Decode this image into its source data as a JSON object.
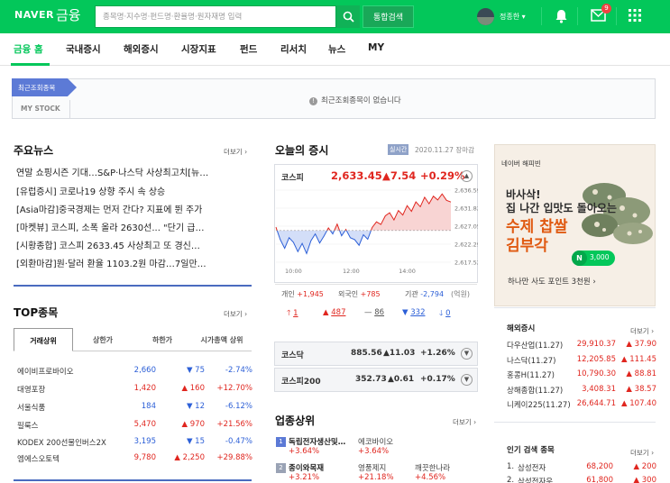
{
  "header": {
    "logo": "NAVER",
    "logo_sub": "금융",
    "search_placeholder": "종목명·지수명·펀드명·환율명·원자재명 입력",
    "total_search": "통합검색",
    "username": "정종한 ▾",
    "mail_badge": "9"
  },
  "nav": {
    "items": [
      "금융 홈",
      "국내증시",
      "해외증시",
      "시장지표",
      "펀드",
      "리서치",
      "뉴스",
      "MY"
    ]
  },
  "recent": {
    "tag": "최근조회종목",
    "mystock": "MY STOCK",
    "message": "최근조회종목이 없습니다"
  },
  "news": {
    "title": "주요뉴스",
    "more": "더보기",
    "items": [
      "연말 쇼핑시즌 기대…S&P·나스닥 사상최고치[뉴…",
      "[유럽증시] 코로나19 상향 주시 속 상승",
      "[Asia마감]중국경제는 먼저 간다? 지표에 뛴 주가",
      "[마켓뷰] 코스피, 소폭 올라 2630선... \"단기 급…",
      "[시황종합] 코스피 2633.45 사상최고 또 경신…",
      "[외환마감]원·달러 환율 1103.2원 마감…7일만…"
    ]
  },
  "top": {
    "title": "TOP종목",
    "more": "더보기",
    "tabs": [
      "거래상위",
      "상한가",
      "하한가",
      "시가총액 상위"
    ],
    "rows": [
      {
        "name": "에이비프로바이오",
        "price": "2,660",
        "chg": "▼ 75",
        "pct": "-2.74%",
        "dir": "down"
      },
      {
        "name": "대영포장",
        "price": "1,420",
        "chg": "▲ 160",
        "pct": "+12.70%",
        "dir": "up"
      },
      {
        "name": "서울식품",
        "price": "184",
        "chg": "▼ 12",
        "pct": "-6.12%",
        "dir": "down"
      },
      {
        "name": "필룩스",
        "price": "5,470",
        "chg": "▲ 970",
        "pct": "+21.56%",
        "dir": "up"
      },
      {
        "name": "KODEX 200선물인버스2X",
        "price": "3,195",
        "chg": "▼ 15",
        "pct": "-0.47%",
        "dir": "down"
      },
      {
        "name": "엠에스오토텍",
        "price": "9,780",
        "chg": "▲ 2,250",
        "pct": "+29.88%",
        "dir": "up"
      }
    ]
  },
  "today": {
    "title": "오늘의 증시",
    "realtime": "실시간",
    "date": "2020.11.27 장마감",
    "kospi_label": "코스피",
    "kospi_value": "2,633.45",
    "kospi_chg": "▲7.54",
    "kospi_pct": "+0.29%",
    "investors": {
      "individual_label": "개인",
      "individual": "+1,945",
      "foreign_label": "외국인",
      "foreign": "+785",
      "inst_label": "기관",
      "inst": "-2,794",
      "unit": "(억원)"
    },
    "breadth": {
      "limit_up": "1",
      "up": "487",
      "flat": "86",
      "down": "332",
      "limit_down": "0"
    },
    "kosdaq_label": "코스닥",
    "kosdaq_value": "885.56",
    "kosdaq_chg": "▲11.03",
    "kosdaq_pct": "+1.26%",
    "k200_label": "코스피200",
    "k200_value": "352.73",
    "k200_chg": "▲0.61",
    "k200_pct": "+0.17%"
  },
  "chart_data": {
    "type": "line",
    "title": "",
    "x_ticks": [
      "10:00",
      "12:00",
      "14:00"
    ],
    "y_ticks": [
      "2,636.59",
      "2,631.82",
      "2,627.05",
      "2,622.29",
      "2,617.52"
    ],
    "ylim": [
      2617.52,
      2636.59
    ],
    "baseline": 2625.91,
    "values": [
      2626.8,
      2623.5,
      2621.2,
      2624.0,
      2622.8,
      2620.3,
      2622.5,
      2619.8,
      2623.2,
      2625.0,
      2622.6,
      2624.5,
      2626.6,
      2625.0,
      2627.6,
      2624.5,
      2626.2,
      2624.0,
      2623.5,
      2622.0,
      2624.8,
      2623.6,
      2626.7,
      2628.2,
      2627.5,
      2629.8,
      2630.6,
      2628.7,
      2631.2,
      2630.0,
      2632.5,
      2631.0,
      2633.5,
      2632.2,
      2634.7,
      2633.0,
      2635.0,
      2634.0,
      2635.6,
      2633.9,
      2633.45
    ],
    "colors": {
      "up": "#e0261f",
      "down": "#2c5fd7",
      "fill_up": "#f8d4d3",
      "fill_down": "#d3def8"
    }
  },
  "sectors": {
    "title": "업종상위",
    "more": "더보기",
    "rows": [
      {
        "num": "1",
        "name": "독립전자생산및…",
        "pct": "+3.64%",
        "sub": "에코바이오",
        "sub_pct": "+3.64%"
      },
      {
        "num": "2",
        "name": "종이와목재",
        "pct": "+3.21%",
        "sub": "영풍제지",
        "sub_pct": "+21.18%",
        "sub2": "깨끗한나라",
        "sub2_pct": "+4.56%"
      }
    ]
  },
  "ad": {
    "label": "네이버 해피빈",
    "line1": "바사삭!",
    "line2": "집 나간 입맛도 돌아오는",
    "line3": "수제 찹쌀",
    "line4": "김부각",
    "point": "3,000",
    "n": "N",
    "foot": "하나만 사도 포인트 3천원 ›"
  },
  "overseas": {
    "title": "해외증시",
    "more": "더보기",
    "rows": [
      {
        "name": "다우산업(11.27)",
        "value": "29,910.37",
        "chg": "▲ 37.90"
      },
      {
        "name": "나스닥(11.27)",
        "value": "12,205.85",
        "chg": "▲ 111.45"
      },
      {
        "name": "홍콩H(11.27)",
        "value": "10,790.30",
        "chg": "▲ 88.81"
      },
      {
        "name": "상해종합(11.27)",
        "value": "3,408.31",
        "chg": "▲ 38.57"
      },
      {
        "name": "니케이225(11.27)",
        "value": "26,644.71",
        "chg": "▲ 107.40"
      }
    ]
  },
  "popular": {
    "title": "인기 검색 종목",
    "more": "더보기",
    "rows": [
      {
        "rank": "1.",
        "name": "삼성전자",
        "value": "68,200",
        "chg": "▲ 200"
      },
      {
        "rank": "2.",
        "name": "삼성전자우",
        "value": "61,800",
        "chg": "▲ 300"
      }
    ]
  }
}
